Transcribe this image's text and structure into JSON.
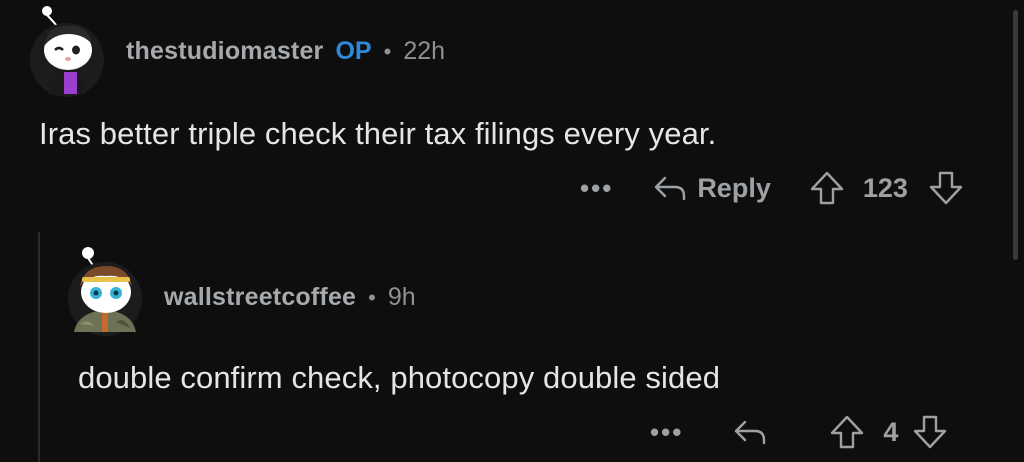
{
  "comments": [
    {
      "username": "thestudiomaster",
      "op_badge": "OP",
      "separator": "•",
      "time": "22h",
      "text": "Iras better triple check their tax filings every year.",
      "more_label": "•••",
      "reply_label": "Reply",
      "vote_count": "123"
    },
    {
      "username": "wallstreetcoffee",
      "separator": "•",
      "time": "9h",
      "text": "double confirm check, photocopy double sided",
      "more_label": "•••",
      "vote_count": "4"
    }
  ],
  "icons": {
    "more": "more-options-icon",
    "reply": "reply-arrow-icon",
    "upvote": "upvote-arrow-icon",
    "downvote": "downvote-arrow-icon"
  },
  "colors": {
    "background": "#0e0e0f",
    "op_badge": "#2f88d8",
    "username": "#a7aaad",
    "body_text": "#e3e5e7",
    "muted": "#8e9093"
  }
}
